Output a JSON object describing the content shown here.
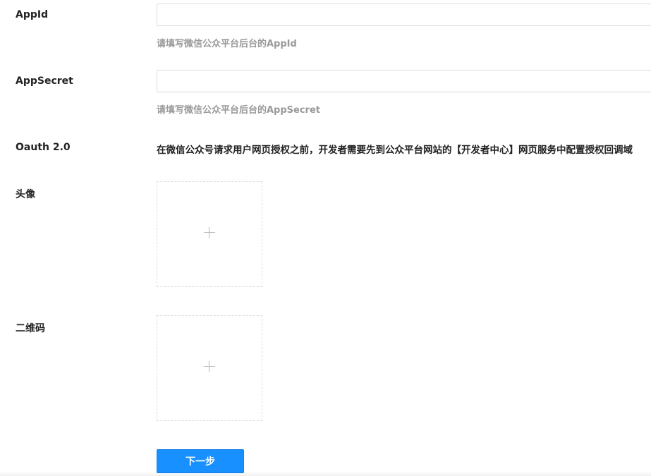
{
  "form": {
    "appid": {
      "label": "AppId",
      "value": "",
      "hint": "请填写微信公众平台后台的AppId"
    },
    "appsecret": {
      "label": "AppSecret",
      "value": "",
      "hint": "请填写微信公众平台后台的AppSecret"
    },
    "oauth": {
      "label": "Oauth 2.0",
      "text": "在微信公众号请求用户网页授权之前，开发者需要先到公众平台网站的【开发者中心】网页服务中配置授权回调域"
    },
    "avatar": {
      "label": "头像",
      "upload_icon": "plus-icon"
    },
    "qrcode": {
      "label": "二维码",
      "upload_icon": "plus-icon"
    },
    "next_button_label": "下一步"
  },
  "colors": {
    "primary": "#1890ff",
    "hint": "#999999",
    "border": "#dcdcdc"
  }
}
